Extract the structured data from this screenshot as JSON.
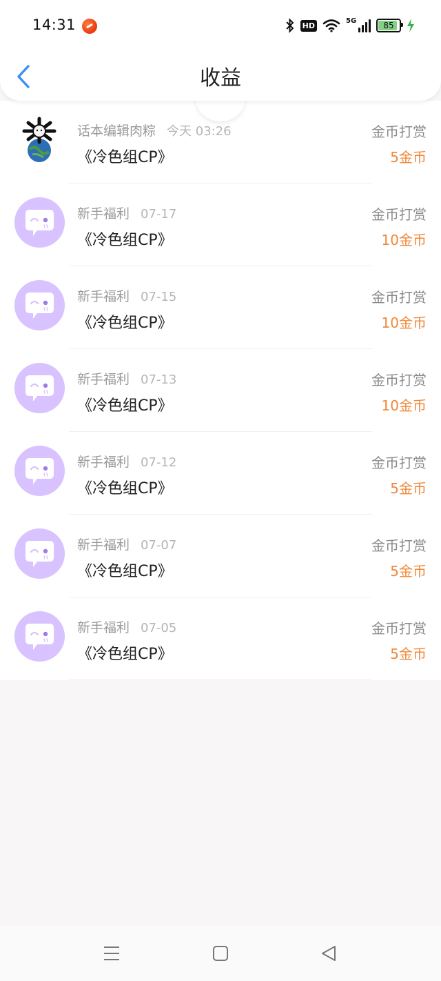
{
  "status_bar": {
    "time": "14:31",
    "hd_label": "HD",
    "network_label": "5G",
    "battery_level": "85"
  },
  "header": {
    "title": "收益",
    "back_icon": "chevron-left-icon"
  },
  "colors": {
    "accent_blue": "#3a8ff0",
    "amount_orange": "#f0883a",
    "avatar_purple": "#d8c2ff"
  },
  "records": [
    {
      "source": "话本编辑肉粽",
      "date": "今天 03:26",
      "book": "《冷色组CP》",
      "type": "金币打赏",
      "amount": "5金币",
      "avatar": "custom-avatar"
    },
    {
      "source": "新手福利",
      "date": "07-17",
      "book": "《冷色组CP》",
      "type": "金币打赏",
      "amount": "10金币",
      "avatar": "chat-bubble-avatar"
    },
    {
      "source": "新手福利",
      "date": "07-15",
      "book": "《冷色组CP》",
      "type": "金币打赏",
      "amount": "10金币",
      "avatar": "chat-bubble-avatar"
    },
    {
      "source": "新手福利",
      "date": "07-13",
      "book": "《冷色组CP》",
      "type": "金币打赏",
      "amount": "10金币",
      "avatar": "chat-bubble-avatar"
    },
    {
      "source": "新手福利",
      "date": "07-12",
      "book": "《冷色组CP》",
      "type": "金币打赏",
      "amount": "5金币",
      "avatar": "chat-bubble-avatar"
    },
    {
      "source": "新手福利",
      "date": "07-07",
      "book": "《冷色组CP》",
      "type": "金币打赏",
      "amount": "5金币",
      "avatar": "chat-bubble-avatar"
    },
    {
      "source": "新手福利",
      "date": "07-05",
      "book": "《冷色组CP》",
      "type": "金币打赏",
      "amount": "5金币",
      "avatar": "chat-bubble-avatar"
    }
  ],
  "nav_bar": {
    "menu_icon": "menu-icon",
    "home_icon": "home-square-icon",
    "back_icon": "back-triangle-icon"
  }
}
